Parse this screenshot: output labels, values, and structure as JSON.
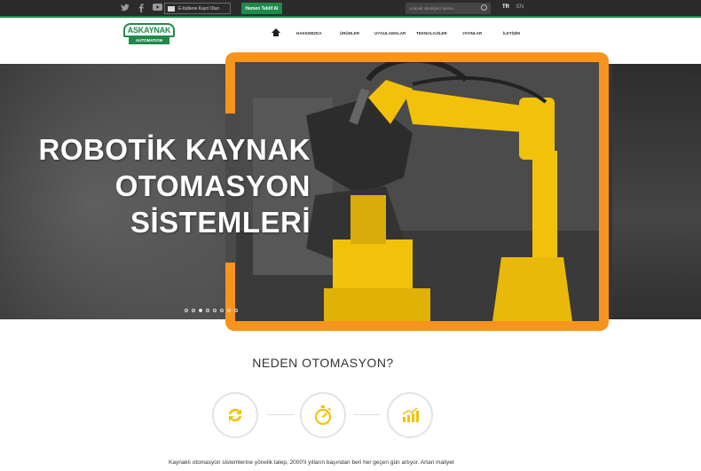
{
  "topbar": {
    "social_icons": [
      "twitter-icon",
      "facebook-icon",
      "youtube-icon"
    ],
    "newsletter_label": "E-bültene Kayıt Olun",
    "quote_label": "Hemen Teklif Al",
    "search_placeholder": "Aramak istediğiniz kelime",
    "languages": [
      {
        "code": "TR",
        "active": true
      },
      {
        "code": "EN",
        "active": false
      }
    ]
  },
  "brand": {
    "logo_top": "ASKAYNAK",
    "logo_bottom": "AUTOMATION"
  },
  "nav": {
    "items": [
      "HAKKIMIZDA",
      "ÜRÜNLER",
      "UYGULAMALAR",
      "TEKNOLOJİLER",
      "YAYINLAR",
      "İLETİŞİM"
    ]
  },
  "hero": {
    "headline_lines": [
      "ROBOTİK KAYNAK",
      "OTOMASYON",
      "SİSTEMLERİ"
    ],
    "slide_count": 8,
    "active_slide": 3
  },
  "section": {
    "title": "NEDEN OTOMASYON?",
    "body": "Kaynaklı otomasyon sistemlerine yönelik talep, 2000'li yılların başından beri her geçen gün artıyor. Artan maliyet"
  },
  "colors": {
    "brand_green": "#1f8a4c",
    "accent_orange": "#f7941d",
    "icon_yellow": "#f2c20a"
  },
  "feature_icons": [
    "refresh-icon",
    "stopwatch-icon",
    "chart-icon"
  ]
}
